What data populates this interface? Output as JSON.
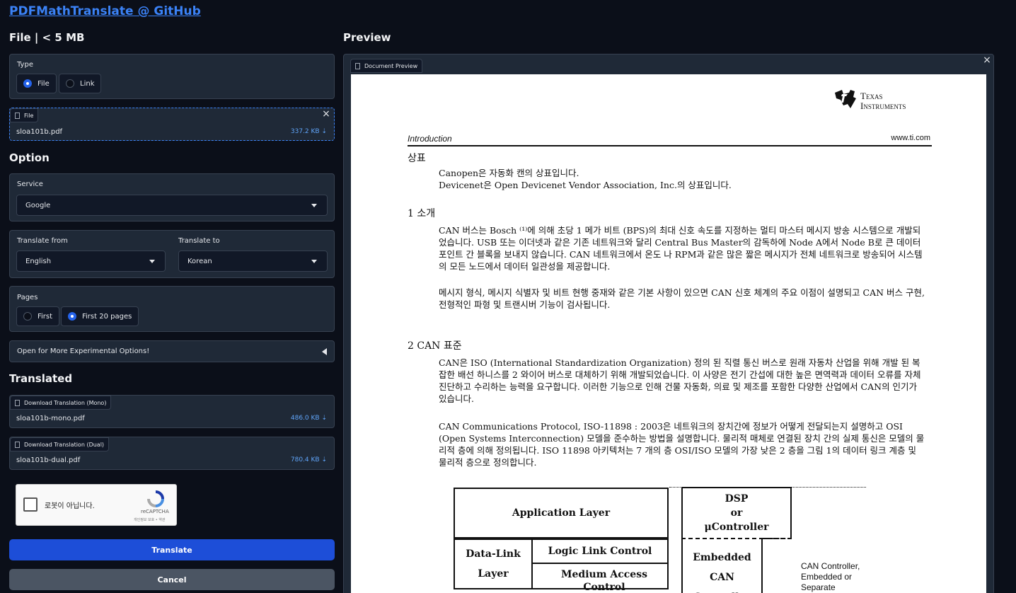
{
  "header": {
    "title": "PDFMathTranslate @ GitHub"
  },
  "left": {
    "file_heading": "File | < 5 MB",
    "type": {
      "label": "Type",
      "options": [
        "File",
        "Link"
      ],
      "selected": "File"
    },
    "file": {
      "tag": "File",
      "name": "sloa101b.pdf",
      "size": "337.2 KB ⇣"
    },
    "option_heading": "Option",
    "service": {
      "label": "Service",
      "value": "Google"
    },
    "translate_from": {
      "label": "Translate from",
      "value": "English"
    },
    "translate_to": {
      "label": "Translate to",
      "value": "Korean"
    },
    "pages": {
      "label": "Pages",
      "options": [
        "First",
        "First 20 pages"
      ],
      "selected": "First 20 pages"
    },
    "experimental": "Open for More Experimental Options!",
    "translated_heading": "Translated",
    "mono": {
      "tag": "Download Translation (Mono)",
      "name": "sloa101b-mono.pdf",
      "size": "486.0 KB ⇣"
    },
    "dual": {
      "tag": "Download Translation (Dual)",
      "name": "sloa101b-dual.pdf",
      "size": "780.4 KB ⇣"
    },
    "captcha": {
      "text": "로봇이 아닙니다.",
      "brand": "reCAPTCHA",
      "links": "개인정보 보호 • 약관"
    },
    "translate_button": "Translate",
    "cancel_button": "Cancel"
  },
  "preview": {
    "heading": "Preview",
    "tag": "Document Preview",
    "doc": {
      "logo_line1": "Texas",
      "logo_line2": "Instruments",
      "header_left": "Introduction",
      "header_right": "www.ti.com",
      "sec_trademark": "상표",
      "tm1": "Canopen은 자동화 캔의 상표입니다.",
      "tm2": "Devicenet은 Open Devicenet Vendor Association, Inc.의 상표입니다.",
      "sec1": "1 소개",
      "p1": "CAN 버스는 Bosch ⁽¹⁾에 의해 초당 1 메가 비트 (BPS)의 최대 신호 속도를 지정하는 멀티 마스터 메시지 방송 시스템으로 개발되었습니다. USB 또는 이더넷과 같은 기존 네트워크와 달리 Central Bus Master의 감독하에 Node A에서 Node B로 큰 데이터 포인트 간 블록을 보내지 않습니다. CAN 네트워크에서 온도 나 RPM과 같은 많은 짧은 메시지가 전체 네트워크로 방송되어 시스템의 모든 노드에서 데이터 일관성을 제공합니다.",
      "p2": "메시지 형식, 메시지 식별자 및 비트 현행 중재와 같은 기본 사항이 있으면 CAN 신호 체계의 주요 이점이 설명되고 CAN 버스 구현, 전형적인 파형 및 트랜시버 기능이 검사됩니다.",
      "sec2": "2 CAN 표준",
      "p3": "CAN은 ISO (International Standardization Organization) 정의 된 직렬 통신 버스로 원래 자동차 산업을 위해 개발 된 복잡한 배선 하니스를 2 와이어 버스로 대체하기 위해 개발되었습니다. 이 사양은 전기 간섭에 대한 높은 면역력과 데이터 오류를 자체 진단하고 수리하는 능력을 요구합니다. 이러한 기능으로 인해 건물 자동화, 의료 및 제조를 포함한 다양한 산업에서 CAN의 인기가 있습니다.",
      "p4": "CAN Communications Protocol, ISO-11898 : 2003은 네트워크의 장치간에 정보가 어떻게 전달되는지 설명하고 OSI (Open Systems Interconnection) 모델을 준수하는 방법을 설명합니다. 물리적 매체로 연결된 장치 간의 실제 통신은 모델의 물리적 층에 의해 정의됩니다. ISO 11898 아키텍처는 7 개의 층 OSI/ISO 모델의 가장 낮은 2 층을 그림 1의 데이터 링크 계층 및 물리적 층으로 정의합니다.",
      "diagram": {
        "app_layer": "Application Layer",
        "dsp": "DSP\nor\nμController",
        "data_link": "Data-Link\nLayer",
        "llc": "Logic Link Control",
        "mac": "Medium Access Control",
        "embedded": "Embedded\nCAN\nController",
        "side_label": "CAN Controller,\nEmbedded or\nSeparate"
      }
    }
  },
  "colors": {
    "accent": "#2563eb",
    "link": "#3b82f6",
    "panel": "#1f2937",
    "bg": "#0b0f19"
  }
}
